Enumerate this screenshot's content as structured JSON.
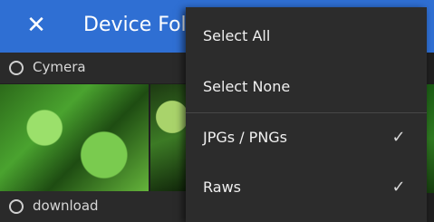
{
  "app_bar": {
    "close_icon": "close-icon",
    "title": "Device Fol"
  },
  "sections": [
    {
      "label": "Cymera"
    },
    {
      "label": "download"
    }
  ],
  "menu": {
    "items": [
      {
        "label": "Select All",
        "checked": false
      },
      {
        "label": "Select None",
        "checked": false
      },
      {
        "label": "JPGs / PNGs",
        "checked": true,
        "check_glyph": "✓"
      },
      {
        "label": "Raws",
        "checked": true,
        "check_glyph": "✓"
      }
    ]
  },
  "colors": {
    "app_bar": "#2f6fd3",
    "menu_bg": "#2c2c2c",
    "background": "#1f1f1f"
  }
}
